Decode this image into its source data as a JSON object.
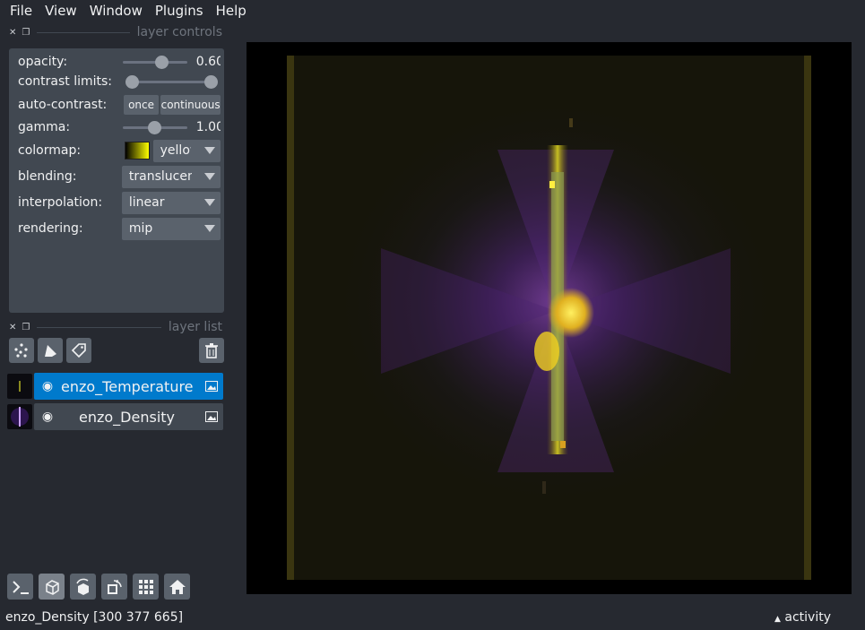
{
  "menu": [
    "File",
    "View",
    "Window",
    "Plugins",
    "Help"
  ],
  "layer_controls": {
    "title": "layer controls",
    "opacity": {
      "label": "opacity:",
      "value": "0.60",
      "fraction": 0.6
    },
    "contrast_limits": {
      "label": "contrast limits:",
      "low": 0.0,
      "high": 1.0
    },
    "auto_contrast": {
      "label": "auto-contrast:",
      "once": "once",
      "continuous": "continuous"
    },
    "gamma": {
      "label": "gamma:",
      "value": "1.00",
      "fraction": 0.5
    },
    "colormap": {
      "label": "colormap:",
      "value": "yellow",
      "color": "#ffff00"
    },
    "blending": {
      "label": "blending:",
      "value": "translucent"
    },
    "interpolation": {
      "label": "interpolation:",
      "value": "linear"
    },
    "rendering": {
      "label": "rendering:",
      "value": "mip"
    }
  },
  "layer_list": {
    "title": "layer list",
    "layers": [
      {
        "name": "enzo_Temperature",
        "selected": true,
        "visible": true
      },
      {
        "name": "enzo_Density",
        "selected": false,
        "visible": true
      }
    ]
  },
  "status": {
    "text": "enzo_Density [300 377 665]",
    "activity": "activity"
  },
  "colors": {
    "background": "#262930",
    "panel": "#414851",
    "selected": "#007acc",
    "button": "#5a626c"
  }
}
